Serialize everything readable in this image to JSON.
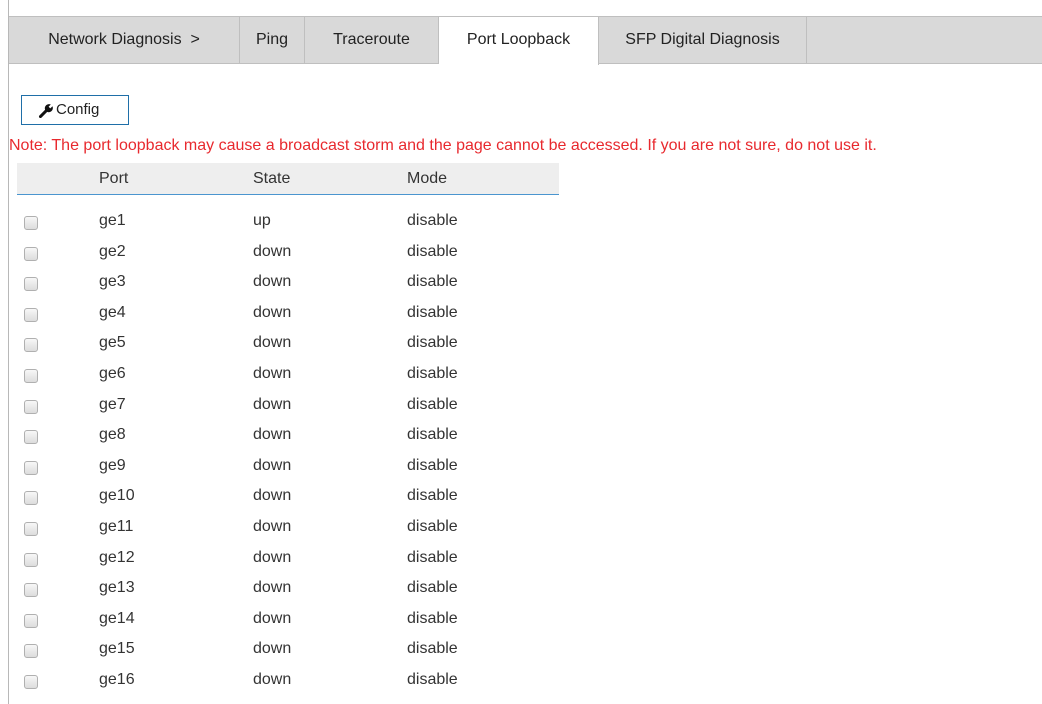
{
  "breadcrumb": "Network Diagnosis  >",
  "tabs": [
    {
      "label": "Ping",
      "active": false
    },
    {
      "label": "Traceroute",
      "active": false
    },
    {
      "label": "Port Loopback",
      "active": true
    },
    {
      "label": "SFP Digital Diagnosis",
      "active": false
    }
  ],
  "toolbar": {
    "config_label": "Config",
    "config_icon": "wrench-icon"
  },
  "note": "Note: The port loopback may cause a broadcast storm and the page cannot be accessed. If you are not sure, do not use it.",
  "table": {
    "columns": [
      "Port",
      "State",
      "Mode"
    ],
    "rows": [
      {
        "port": "ge1",
        "state": "up",
        "mode": "disable"
      },
      {
        "port": "ge2",
        "state": "down",
        "mode": "disable"
      },
      {
        "port": "ge3",
        "state": "down",
        "mode": "disable"
      },
      {
        "port": "ge4",
        "state": "down",
        "mode": "disable"
      },
      {
        "port": "ge5",
        "state": "down",
        "mode": "disable"
      },
      {
        "port": "ge6",
        "state": "down",
        "mode": "disable"
      },
      {
        "port": "ge7",
        "state": "down",
        "mode": "disable"
      },
      {
        "port": "ge8",
        "state": "down",
        "mode": "disable"
      },
      {
        "port": "ge9",
        "state": "down",
        "mode": "disable"
      },
      {
        "port": "ge10",
        "state": "down",
        "mode": "disable"
      },
      {
        "port": "ge11",
        "state": "down",
        "mode": "disable"
      },
      {
        "port": "ge12",
        "state": "down",
        "mode": "disable"
      },
      {
        "port": "ge13",
        "state": "down",
        "mode": "disable"
      },
      {
        "port": "ge14",
        "state": "down",
        "mode": "disable"
      },
      {
        "port": "ge15",
        "state": "down",
        "mode": "disable"
      },
      {
        "port": "ge16",
        "state": "down",
        "mode": "disable"
      }
    ]
  },
  "colors": {
    "note": "#e8292e",
    "tabbar_bg": "#d9d9d9",
    "header_accent": "#4a95cf"
  }
}
